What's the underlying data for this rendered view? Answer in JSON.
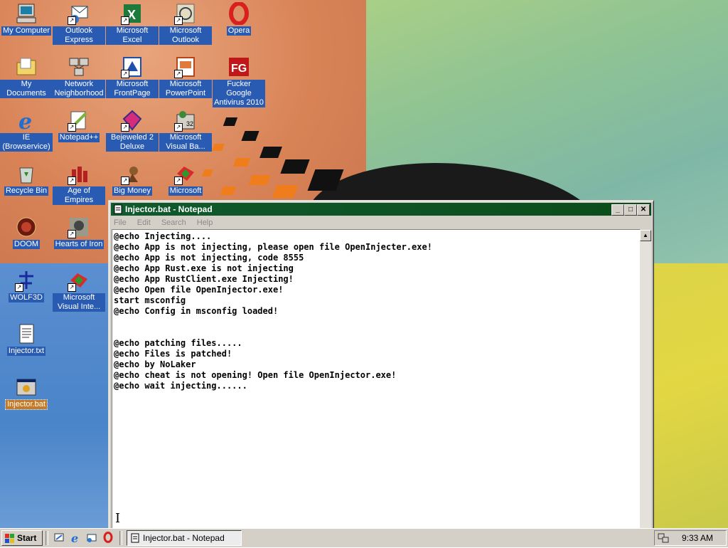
{
  "desktop": {
    "icons": [
      {
        "label": "My Computer",
        "icon": "my-computer-icon"
      },
      {
        "label": "Outlook Express",
        "icon": "outlook-express-icon"
      },
      {
        "label": "Microsoft Excel",
        "icon": "excel-icon"
      },
      {
        "label": "Microsoft Outlook",
        "icon": "outlook-icon"
      },
      {
        "label": "Opera",
        "icon": "opera-icon"
      },
      {
        "label": "My Documents",
        "icon": "my-documents-icon"
      },
      {
        "label": "Network Neighborhood",
        "icon": "network-neighborhood-icon"
      },
      {
        "label": "Microsoft FrontPage",
        "icon": "frontpage-icon"
      },
      {
        "label": "Microsoft PowerPoint",
        "icon": "powerpoint-icon"
      },
      {
        "label": "Fucker Google Antivirus 2010",
        "icon": "antivirus-icon"
      },
      {
        "label": "IE (Browservice)",
        "icon": "internet-explorer-icon"
      },
      {
        "label": "Notepad++",
        "icon": "notepad-plus-plus-icon"
      },
      {
        "label": "Bejeweled 2 Deluxe",
        "icon": "bejeweled-icon"
      },
      {
        "label": "Microsoft Visual Ba...",
        "icon": "visual-basic-icon"
      },
      {
        "label": "Recycle Bin",
        "icon": "recycle-bin-icon"
      },
      {
        "label": "Age of Empires",
        "icon": "age-of-empires-icon"
      },
      {
        "label": "Big Money",
        "icon": "big-money-icon"
      },
      {
        "label": "Microsoft",
        "icon": "visual-interdev-icon"
      },
      {
        "label": "DOOM",
        "icon": "doom-icon"
      },
      {
        "label": "Hearts of Iron",
        "icon": "hearts-of-iron-icon"
      },
      {
        "label": "WOLF3D",
        "icon": "wolf3d-icon"
      },
      {
        "label": "Microsoft Visual Inte...",
        "icon": "visual-interdev-icon"
      },
      {
        "label": "Injector.txt",
        "icon": "text-file-icon"
      },
      {
        "label": "Injector.bat",
        "icon": "batch-file-icon"
      }
    ]
  },
  "notepad": {
    "title": "Injector.bat - Notepad",
    "menu": {
      "file": "File",
      "edit": "Edit",
      "search": "Search",
      "help": "Help"
    },
    "content": "@echo Injecting....\n@echo App is not injecting, please open file OpenInjecter.exe!\n@echo App is not injecting, code 8555\n@echo App Rust.exe is not injecting\n@echo App RustClient.exe Injecting!\n@echo Open file OpenInjector.exe!\nstart msconfig\n@echo Config in msconfig loaded!\n\n\n@echo patching files.....\n@echo Files is patched!\n@echo by NoLaker\n@echo cheat is not opening! Open file OpenInjector.exe!\n@echo wait injecting......",
    "caption_buttons": {
      "minimize": "_",
      "maximize": "□",
      "close": "✕"
    }
  },
  "taskbar": {
    "start_label": "Start",
    "task_label": "Injector.bat - Notepad",
    "clock": "9:33 AM"
  }
}
